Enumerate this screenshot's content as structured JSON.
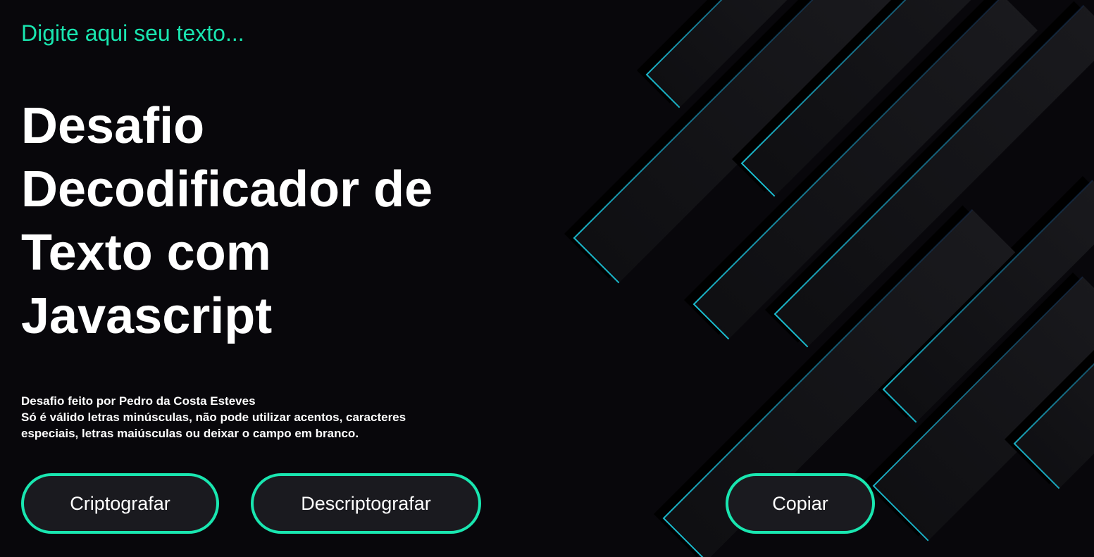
{
  "input": {
    "placeholder": "Digite aqui seu texto..."
  },
  "main": {
    "title": "Desafio Decodificador de Texto com Javascript",
    "author_note": "Desafio feito por Pedro da Costa Esteves",
    "rules_note": "Só é válido letras minúsculas, não pode utilizar acentos, caracteres especiais, letras maiúsculas ou deixar o campo em branco."
  },
  "buttons": {
    "encrypt_label": "Criptografar",
    "decrypt_label": "Descriptografar",
    "copy_label": "Copiar"
  },
  "colors": {
    "background": "#08070b",
    "accent": "#19e6b0",
    "button_fill": "#1a1a1f",
    "stripe_outline": "#1bc7d8"
  }
}
